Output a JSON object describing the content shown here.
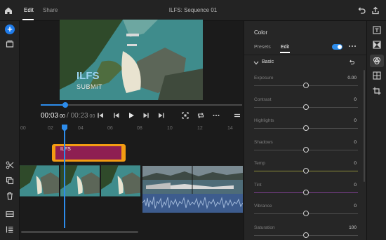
{
  "header": {
    "tabs": [
      {
        "label": "Edit"
      },
      {
        "label": "Share"
      }
    ],
    "title": "ILFS: Sequence 01"
  },
  "left_rail": {
    "icons": [
      "home-icon",
      "add-icon",
      "media-icon",
      "scissors-icon",
      "duplicate-icon",
      "delete-icon",
      "captions-icon",
      "tracks-icon"
    ]
  },
  "preview": {
    "overlay_title": "ILFS",
    "overlay_subtitle": "SUBMIT"
  },
  "transport": {
    "current_time": "00:03",
    "current_frames": "00",
    "duration_time": "00:23",
    "duration_frames": "00",
    "playback_progress": 0.13
  },
  "timeline": {
    "ruler_labels": [
      "00",
      "02",
      "04",
      "06",
      "08",
      "10",
      "12",
      "14"
    ],
    "title_clip_label": "ILFS"
  },
  "color_panel": {
    "title": "Color",
    "tabs": [
      {
        "label": "Presets"
      },
      {
        "label": "Edit"
      }
    ],
    "section": "Basic",
    "enabled": true,
    "properties": [
      {
        "label": "Exposure",
        "value": "0.00",
        "slider": 0.5,
        "track_color": "#4c4c4c"
      },
      {
        "label": "Contrast",
        "value": "0",
        "slider": 0.5,
        "track_color": "#4c4c4c"
      },
      {
        "label": "Highlights",
        "value": "0",
        "slider": 0.5,
        "track_color": "#4c4c4c"
      },
      {
        "label": "Shadows",
        "value": "0",
        "slider": 0.5,
        "track_color": "#4c4c4c"
      },
      {
        "label": "Temp",
        "value": "0",
        "slider": 0.5,
        "track_color": "#8c8c3a"
      },
      {
        "label": "Tint",
        "value": "0",
        "slider": 0.5,
        "track_color": "#7a3f8c"
      },
      {
        "label": "Vibrance",
        "value": "0",
        "slider": 0.5,
        "track_color": "#4c4c4c"
      },
      {
        "label": "Saturation",
        "value": "100",
        "slider": 0.5,
        "track_color": "#4c4c4c"
      }
    ]
  },
  "colors": {
    "accent": "#2d8ceb",
    "title_clip_border": "#f39c12",
    "title_clip_fill": "#8e1f52"
  }
}
